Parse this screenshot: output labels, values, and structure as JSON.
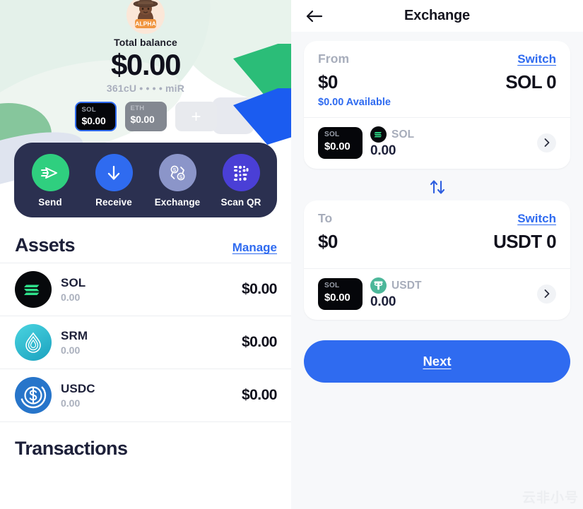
{
  "wallet": {
    "avatar_badge": "ALPHA",
    "avatar_icon": "user-avatar-hat",
    "total_label": "Total balance",
    "total_amount": "$0.00",
    "address": "361cU • • • • miR",
    "chips": [
      {
        "symbol": "SOL",
        "value": "$0.00",
        "selected": true
      },
      {
        "symbol": "ETH",
        "value": "$0.00",
        "selected": false
      }
    ],
    "add_chip_label": "+",
    "actions": [
      {
        "label": "Send",
        "icon": "send-paper-plane-icon",
        "color": "#2fcf7f"
      },
      {
        "label": "Receive",
        "icon": "arrow-down-icon",
        "color": "#2f6bf0"
      },
      {
        "label": "Exchange",
        "icon": "exchange-swap-icon",
        "color": "#8b95c9"
      },
      {
        "label": "Scan QR",
        "icon": "qr-code-icon",
        "color": "#4a3fd6"
      }
    ],
    "assets_section": {
      "title": "Assets",
      "manage_label": "Manage",
      "rows": [
        {
          "symbol": "SOL",
          "amount": "0.00",
          "fiat": "$0.00",
          "icon": "sol-token-icon"
        },
        {
          "symbol": "SRM",
          "amount": "0.00",
          "fiat": "$0.00",
          "icon": "srm-token-icon"
        },
        {
          "symbol": "USDC",
          "amount": "0.00",
          "fiat": "$0.00",
          "icon": "usdc-token-icon"
        }
      ]
    },
    "transactions_section": {
      "title": "Transactions"
    }
  },
  "exchange": {
    "title": "Exchange",
    "back_icon": "arrow-left-icon",
    "from": {
      "direction_label": "From",
      "switch_label": "Switch",
      "fiat_amount": "$0",
      "token_amount": "SOL 0",
      "available_label": "$0.00 Available",
      "chip_symbol": "SOL",
      "chip_value": "$0.00",
      "token_name": "SOL",
      "token_balance": "0.00",
      "chevron_icon": "chevron-right-icon"
    },
    "swap_icon": "swap-vertical-arrows-icon",
    "to": {
      "direction_label": "To",
      "switch_label": "Switch",
      "fiat_amount": "$0",
      "token_amount": "USDT 0",
      "chip_symbol": "SOL",
      "chip_value": "$0.00",
      "token_name": "USDT",
      "token_balance": "0.00",
      "chevron_icon": "chevron-right-icon"
    },
    "next_label": "Next",
    "watermark": "云非小号"
  },
  "colors": {
    "accent_blue": "#2f6bf0",
    "green": "#2fcf7f",
    "dark_navy": "#2b3050",
    "muted_grey": "#a7adbb",
    "page_bg": "#f7f8fa"
  }
}
